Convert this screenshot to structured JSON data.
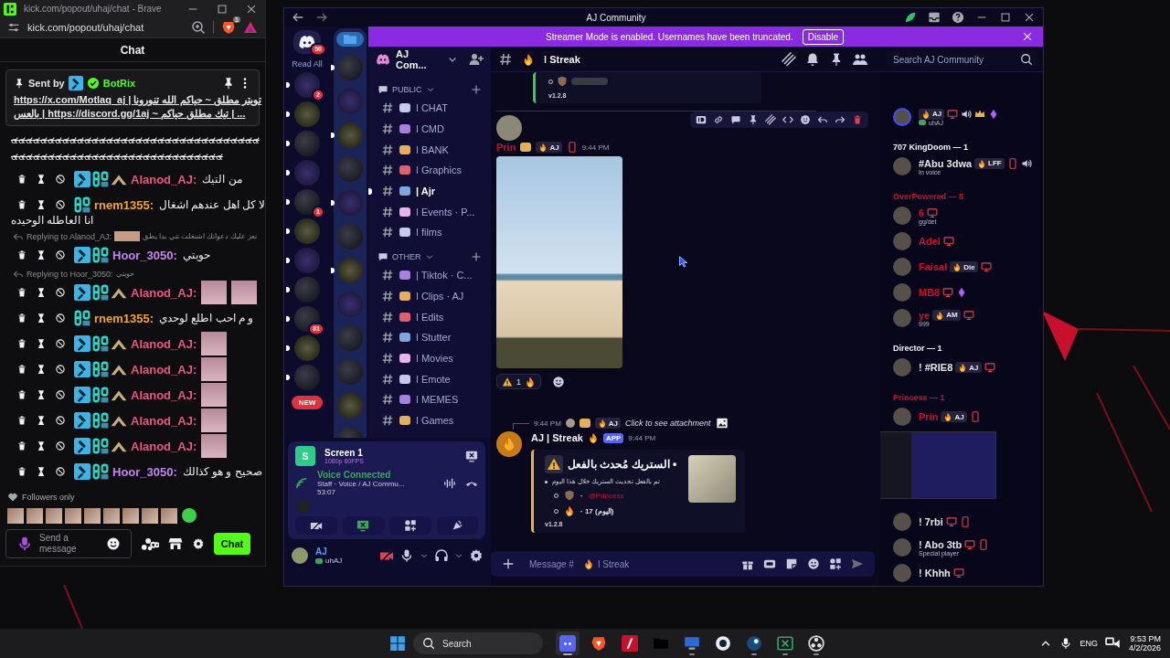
{
  "kick_window": {
    "title": "kick.com/popout/uhaj/chat - Brave",
    "address": "kick.com/popout/uhaj/chat",
    "shields_count": "1",
    "chat_title": "Chat",
    "pinned": {
      "sent_by": "Sent by",
      "bot": "BotRix",
      "lines": [
        "https://x.com/Motlaq_aj | تويتر مطلق ~ حياكم الله تنورونا",
        "بالعس | https://discord.gg/1aj ~ تيك مطلق حياكم | ..."
      ]
    },
    "messages": [
      {
        "kind": "wall",
        "text": "๔๔๔๔๔๔๔๔๔๔๔๔๔๔๔๔๔๔๔๔๔๔๔๔๔๔๔๔๔๔๔๔๔๔๔๔๔๔๔๔๔๔๔๔๔๔๔๔๔๔๔๔๔๔๔๔๔๔๔๔๔๔๔"
      },
      {
        "kind": "chat",
        "badges": [
          {
            "kind": "mod"
          },
          {
            "kind": "sub"
          },
          {
            "kind": "vip"
          }
        ],
        "user": "Alanod_AJ:",
        "color": "#e8587f",
        "text": "من التيك"
      },
      {
        "kind": "chat",
        "badges": [
          {
            "kind": "sub"
          }
        ],
        "user": "rnem1355:",
        "color": "#f5a524",
        "text": "لا كل اهل عندهم اشغال",
        "text_continued": "انا العاطله الوحيده"
      },
      {
        "kind": "reply",
        "label": "Replying to Alanod_AJ:",
        "thumb": true,
        "quote": "تعز عليك دعواتك اشتغلت تتي بدا يطق"
      },
      {
        "kind": "chat",
        "badges": [
          {
            "kind": "mod"
          },
          {
            "kind": "sub"
          }
        ],
        "user": "Hoor_3050:",
        "color": "#c583f2",
        "text": "حوبتي"
      },
      {
        "kind": "reply",
        "label": "Replying to Hoor_3050:",
        "thumb": false,
        "quote": "حوبتي"
      },
      {
        "kind": "chat",
        "badges": [
          {
            "kind": "mod"
          },
          {
            "kind": "sub"
          },
          {
            "kind": "vip"
          }
        ],
        "user": "Alanod_AJ:",
        "color": "#e8587f",
        "attachments": [
          {
            "kind": "photo"
          },
          {
            "kind": "photo"
          }
        ]
      },
      {
        "kind": "chat",
        "badges": [
          {
            "kind": "sub"
          }
        ],
        "user": "rnem1355:",
        "color": "#f5a524",
        "text": "و م احب اطلع لوحدي"
      },
      {
        "kind": "chat",
        "badges": [
          {
            "kind": "mod"
          },
          {
            "kind": "sub"
          },
          {
            "kind": "vip"
          }
        ],
        "user": "Alanod_AJ:",
        "color": "#e8587f",
        "attachments": [
          {
            "kind": "photo"
          }
        ]
      },
      {
        "kind": "chat",
        "badges": [
          {
            "kind": "mod"
          },
          {
            "kind": "sub"
          },
          {
            "kind": "vip"
          }
        ],
        "user": "Alanod_AJ:",
        "color": "#e8587f",
        "attachments": [
          {
            "kind": "photo"
          }
        ]
      },
      {
        "kind": "chat",
        "badges": [
          {
            "kind": "mod"
          },
          {
            "kind": "sub"
          },
          {
            "kind": "vip"
          }
        ],
        "user": "Alanod_AJ:",
        "color": "#e8587f",
        "attachments": [
          {
            "kind": "photo"
          }
        ]
      },
      {
        "kind": "chat",
        "badges": [
          {
            "kind": "mod"
          },
          {
            "kind": "sub"
          },
          {
            "kind": "vip"
          }
        ],
        "user": "Alanod_AJ:",
        "color": "#e8587f",
        "attachments": [
          {
            "kind": "photo"
          }
        ]
      },
      {
        "kind": "chat",
        "badges": [
          {
            "kind": "mod"
          },
          {
            "kind": "sub"
          },
          {
            "kind": "vip"
          }
        ],
        "user": "Alanod_AJ:",
        "color": "#e8587f",
        "attachments": [
          {
            "kind": "photo"
          }
        ]
      },
      {
        "kind": "chat",
        "badges": [
          {
            "kind": "mod"
          },
          {
            "kind": "sub"
          }
        ],
        "user": "Hoor_3050:",
        "color": "#c583f2",
        "text": "صحيح و هو كذالك"
      }
    ],
    "followers_only": "Followers only",
    "recent_emotes": [
      {
        "kind": "photo"
      },
      {
        "kind": "photo"
      },
      {
        "kind": "photo"
      },
      {
        "kind": "photo"
      },
      {
        "kind": "photo"
      },
      {
        "kind": "photo"
      },
      {
        "kind": "photo"
      },
      {
        "kind": "photo"
      },
      {
        "kind": "photo"
      },
      {
        "kind": "sticker"
      }
    ],
    "input": {
      "placeholder": "Send a message"
    },
    "send_button": "Chat"
  },
  "discord": {
    "title": "AJ Community",
    "banner": {
      "text": "Streamer Mode is enabled. Usernames have been truncated.",
      "button": "Disable"
    },
    "home_badge": "50",
    "read_all": "Read All",
    "servers": [
      {
        "unread": true,
        "badge": "2"
      },
      {
        "unread": true
      },
      {
        "unread": true
      },
      {
        "unread": true
      },
      {
        "unread": true,
        "badge": "1"
      },
      {
        "unread": true
      },
      {
        "unread": true
      },
      {
        "unread": true
      },
      {
        "unread": true,
        "badge": "81"
      },
      {
        "unread": true
      },
      {
        "unread": true
      }
    ],
    "new_label": "NEW",
    "folder": [
      {
        "kind": "folder"
      },
      {
        "kind": "server",
        "unread": true
      },
      {
        "kind": "server",
        "unread": false
      },
      {
        "kind": "server",
        "unread": true
      },
      {
        "kind": "server",
        "unread": false
      },
      {
        "kind": "server",
        "unread": true
      },
      {
        "kind": "server",
        "unread": false
      },
      {
        "kind": "server",
        "unread": true
      },
      {
        "kind": "server",
        "unread": false
      },
      {
        "kind": "server",
        "unread": false
      },
      {
        "kind": "server",
        "unread": false
      },
      {
        "kind": "server",
        "unread": false
      },
      {
        "kind": "server",
        "unread": false
      }
    ],
    "server_name": "AJ Com...",
    "categories": [
      {
        "name": "PUBLIC",
        "channels": [
          {
            "name": "ǀ CHAT",
            "unread": false
          },
          {
            "name": "ǀ CMD",
            "unread": false
          },
          {
            "name": "ǀ BANK",
            "unread": false
          },
          {
            "name": "ǀ Graphics",
            "unread": false
          },
          {
            "name": "| Ajr",
            "unread": true
          },
          {
            "name": "ǀ Events · P...",
            "unread": false
          },
          {
            "name": "ǀ films",
            "unread": false
          }
        ]
      },
      {
        "name": "OTHER",
        "channels": [
          {
            "name": "| Tiktok · C...",
            "unread": false
          },
          {
            "name": "ǀ Clips · AJ",
            "unread": false
          },
          {
            "name": "ǀ Edits",
            "unread": false
          },
          {
            "name": "ǀ Stutter",
            "unread": false
          },
          {
            "name": "ǀ Movies",
            "unread": false
          },
          {
            "name": "ǀ Emote",
            "unread": false
          },
          {
            "name": "ǀ MEMES",
            "unread": false
          },
          {
            "name": "ǀ Games",
            "unread": false
          }
        ]
      }
    ],
    "voice": {
      "stream_avatar": "S",
      "stream": "Screen 1",
      "quality": "1080p 60FPS",
      "status": "Voice Connected",
      "channel": "Staff · Voice / AJ Commu...",
      "timer": "53:07"
    },
    "user": {
      "name": "AJ",
      "status": "uhAJ"
    },
    "channel": "ǀ Streak",
    "search": {
      "placeholder": "Search AJ Community"
    },
    "messages": [
      {
        "kind": "embed_tail",
        "version": "v1.2.8"
      },
      {
        "kind": "image",
        "author": "Prin",
        "tag": "AJ",
        "time": "9:44 PM",
        "reactions": [
          {
            "count": "1"
          }
        ]
      },
      {
        "kind": "bot",
        "reply": {
          "time": "9:44 PM",
          "tag": "AJ",
          "text": "Click to see attachment"
        },
        "author": "AJ | Streak",
        "app": "APP",
        "time": "9:44 PM",
        "embed": {
          "title": "الستريك مُحدث بالفعل •",
          "line": "تم بالفعل تحديث الستريك خلال هذا اليوم",
          "items": [
            {
              "kind": "shield",
              "sep": "·",
              "mention": "@Princess"
            },
            {
              "kind": "fire",
              "text": "· 17 (اليوم)"
            }
          ],
          "version": "v1.2.8"
        }
      }
    ],
    "composer": {
      "placeholder": "Message #",
      "channel": "ǀ Streak"
    },
    "members": [
      {
        "kind": "member",
        "color": "#3f4dff",
        "tag": "AJ",
        "icons": [
          {
            "kind": "desktop"
          },
          {
            "kind": "voice"
          },
          {
            "kind": "crown"
          },
          {
            "kind": "boost"
          }
        ],
        "status": "uhAJ",
        "status_icon": true
      },
      {
        "kind": "header",
        "text": "707 KingDoom — 1",
        "color": "#f2f3f5"
      },
      {
        "kind": "member",
        "name": "#Abu 3dwa",
        "color": "#e6e6e6",
        "tag": "LFF",
        "icons": [
          {
            "kind": "phone"
          },
          {
            "kind": "voice"
          }
        ],
        "status": "In voice"
      },
      {
        "kind": "header",
        "text": "OverPowered — 5",
        "color": "#c8102e"
      },
      {
        "kind": "member",
        "name": "6",
        "color": "#c8102e",
        "icons": [
          {
            "kind": "desktop"
          }
        ],
        "status": "gg/det"
      },
      {
        "kind": "member",
        "name": "Adel",
        "color": "#c8102e",
        "icons": [
          {
            "kind": "desktop"
          }
        ]
      },
      {
        "kind": "member",
        "name": "Faisal",
        "color": "#c8102e",
        "tag": "Die",
        "icons": [
          {
            "kind": "desktop"
          }
        ]
      },
      {
        "kind": "member",
        "name": "MB8",
        "color": "#c8102e",
        "icons": [
          {
            "kind": "desktop"
          },
          {
            "kind": "boost"
          }
        ]
      },
      {
        "kind": "member",
        "name": "ye",
        "color": "#c8102e",
        "tag": "AM",
        "icons": [
          {
            "kind": "desktop"
          }
        ],
        "status": "999"
      },
      {
        "kind": "header",
        "text": "Director — 1",
        "color": "#f2f3f5"
      },
      {
        "kind": "member",
        "name": "! #RIE8",
        "color": "#e6e6e6",
        "tag": "AJ",
        "icons": [
          {
            "kind": "desktop"
          }
        ]
      },
      {
        "kind": "header",
        "text": "Princess — 1",
        "color": "#c8102e"
      },
      {
        "kind": "member",
        "name": "Prin",
        "color": "#c8102e",
        "tag": "AJ",
        "icons": [
          {
            "kind": "phone"
          }
        ]
      },
      {
        "kind": "preview"
      },
      {
        "kind": "member",
        "name": "! 7rbi",
        "color": "#e6e6e6",
        "icons": [
          {
            "kind": "desktop"
          },
          {
            "kind": "phone"
          }
        ]
      },
      {
        "kind": "member",
        "name": "! Abo 3tb",
        "color": "#e6e6e6",
        "icons": [
          {
            "kind": "desktop"
          },
          {
            "kind": "phone"
          }
        ],
        "status": "Special player"
      },
      {
        "kind": "member",
        "name": "! Khhh",
        "color": "#e6e6e6",
        "icons": [
          {
            "kind": "desktop"
          }
        ]
      }
    ]
  },
  "taskbar": {
    "search": {
      "placeholder": "Search"
    },
    "apps": [
      {
        "kind": "discord",
        "running": true,
        "selected": true
      },
      {
        "kind": "brave",
        "running": false,
        "selected": false
      },
      {
        "kind": "red",
        "running": false,
        "selected": false
      },
      {
        "kind": "folder",
        "running": false,
        "selected": false
      },
      {
        "kind": "pc",
        "running": true,
        "selected": false
      },
      {
        "kind": "cam",
        "running": false,
        "selected": false
      },
      {
        "kind": "steam",
        "running": true,
        "selected": false
      },
      {
        "kind": "sheet",
        "running": true,
        "selected": false
      },
      {
        "kind": "obs",
        "running": true,
        "selected": false
      }
    ],
    "language": "ENG",
    "time": "9:53 PM",
    "date": "4/2/2026"
  }
}
